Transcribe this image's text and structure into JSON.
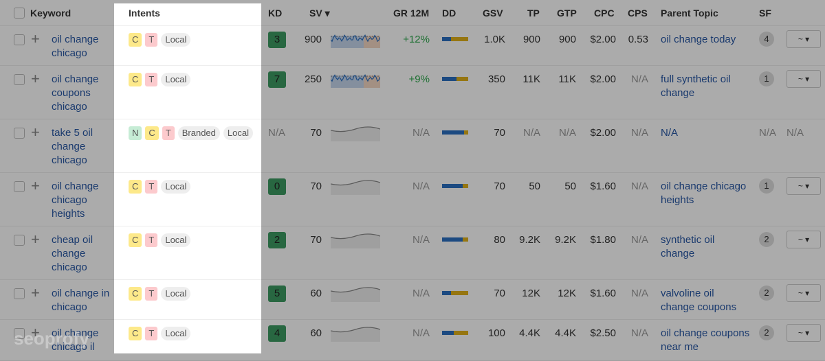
{
  "header": {
    "keyword": "Keyword",
    "intents": "Intents",
    "kd": "KD",
    "sv": "SV ▾",
    "gr": "GR 12M",
    "dd": "DD",
    "gsv": "GSV",
    "tp": "TP",
    "gtp": "GTP",
    "cpc": "CPC",
    "cps": "CPS",
    "parent": "Parent Topic",
    "sf": "SF"
  },
  "colors": {
    "link": "#2857a4",
    "kd": "#3d9a62",
    "dd_blue": "#2a6fc0",
    "dd_yellow": "#e0b11a",
    "growth": "#2ea84c"
  },
  "watermark": "seoprofy",
  "rows": [
    {
      "keyword": "oil change chicago",
      "intents": [
        "C",
        "T",
        "Local"
      ],
      "kd": "3",
      "sv": "900",
      "gr": "+12%",
      "dd": 0.35,
      "gsv": "1.0K",
      "tp": "900",
      "gtp": "900",
      "cpc": "$2.00",
      "cps": "0.53",
      "parent": "oil change today",
      "sf": "4",
      "trend": "~ ▾",
      "spark": "rich"
    },
    {
      "keyword": "oil change coupons chicago",
      "intents": [
        "C",
        "T",
        "Local"
      ],
      "kd": "7",
      "sv": "250",
      "gr": "+9%",
      "dd": 0.55,
      "gsv": "350",
      "tp": "11K",
      "gtp": "11K",
      "cpc": "$2.00",
      "cps": "N/A",
      "parent": "full synthetic oil change",
      "sf": "1",
      "trend": "~ ▾",
      "spark": "rich"
    },
    {
      "keyword": "take 5 oil change chicago",
      "intents": [
        "N",
        "C",
        "T",
        "Branded",
        "Local"
      ],
      "kd": "N/A",
      "sv": "70",
      "gr": "N/A",
      "dd": 0.85,
      "gsv": "70",
      "tp": "N/A",
      "gtp": "N/A",
      "cpc": "$2.00",
      "cps": "N/A",
      "parent": "N/A",
      "sf": "N/A",
      "trend": "N/A",
      "spark": "flat"
    },
    {
      "keyword": "oil change chicago heights",
      "intents": [
        "C",
        "T",
        "Local"
      ],
      "kd": "0",
      "sv": "70",
      "gr": "N/A",
      "dd": 0.8,
      "gsv": "70",
      "tp": "50",
      "gtp": "50",
      "cpc": "$1.60",
      "cps": "N/A",
      "parent": "oil change chicago heights",
      "sf": "1",
      "trend": "~ ▾",
      "spark": "flat"
    },
    {
      "keyword": "cheap oil change chicago",
      "intents": [
        "C",
        "T",
        "Local"
      ],
      "kd": "2",
      "sv": "70",
      "gr": "N/A",
      "dd": 0.8,
      "gsv": "80",
      "tp": "9.2K",
      "gtp": "9.2K",
      "cpc": "$1.80",
      "cps": "N/A",
      "parent": "synthetic oil change",
      "sf": "2",
      "trend": "~ ▾",
      "spark": "flat"
    },
    {
      "keyword": "oil change in chicago",
      "intents": [
        "C",
        "T",
        "Local"
      ],
      "kd": "5",
      "sv": "60",
      "gr": "N/A",
      "dd": 0.35,
      "gsv": "70",
      "tp": "12K",
      "gtp": "12K",
      "cpc": "$1.60",
      "cps": "N/A",
      "parent": "valvoline oil change coupons",
      "sf": "2",
      "trend": "~ ▾",
      "spark": "flat"
    },
    {
      "keyword": "oil change chicago il",
      "intents": [
        "C",
        "T",
        "Local"
      ],
      "kd": "4",
      "sv": "60",
      "gr": "N/A",
      "dd": 0.45,
      "gsv": "100",
      "tp": "4.4K",
      "gtp": "4.4K",
      "cpc": "$2.50",
      "cps": "N/A",
      "parent": "oil change coupons near me",
      "sf": "2",
      "trend": "~ ▾",
      "spark": "flat"
    }
  ]
}
